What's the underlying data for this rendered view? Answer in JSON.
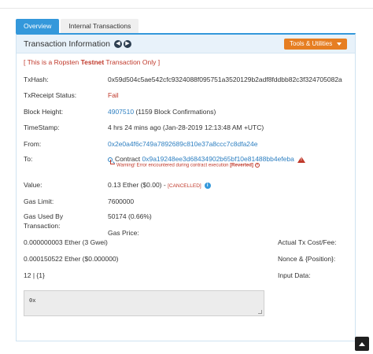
{
  "tabs": [
    {
      "label": "Overview",
      "active": true
    },
    {
      "label": "Internal Transactions",
      "active": false
    }
  ],
  "header": {
    "title": "Transaction Information",
    "tools_label": "Tools & Utilities"
  },
  "notice": {
    "prefix": "[ This is a Ropsten ",
    "bold": "Testnet",
    "suffix": " Transaction Only ]"
  },
  "fields": {
    "txhash_label": "TxHash:",
    "txhash_value": "0x59d504c5ae542cfc9324088f095751a3520129b2adf8fddbb82c3f324705082a",
    "receipt_label": "TxReceipt Status:",
    "receipt_value": "Fail",
    "block_label": "Block Height:",
    "block_value": "4907510",
    "block_confirm": " (1159 Block Confirmations)",
    "time_label": "TimeStamp:",
    "time_value": "4 hrs 24 mins ago (Jan-28-2019 12:13:48 AM +UTC)",
    "from_label": "From:",
    "from_value": "0x2e0a4f6c749a7892689c810e37a8ccc7c8dfa24e",
    "to_label": "To:",
    "to_prefix": "Contract ",
    "to_value": "0x9a19248ee3d68434902b65bf10e81488bb4efeba",
    "warning_prefix": "Warning! Error encountered during contract execution ",
    "warning_bold": "[Reverted]",
    "value_label": "Value:",
    "value_value": "0.13 Ether ($0.00) - ",
    "value_cancelled": "[CANCELLED]",
    "gaslimit_label": "Gas Limit:",
    "gaslimit_value": "7600000",
    "gasused_label_1": "Gas Used By",
    "gasused_label_2": "Transaction:",
    "gasused_value": "50174 (0.66%)",
    "gasprice_label": "Gas Price:",
    "gasprice_value": "0.000000003 Ether (3 Gwei)",
    "actualfee_label": "Actual Tx Cost/Fee:",
    "actualfee_value": "0.000150522 Ether ($0.000000)",
    "nonce_label": "Nonce & {Position}:",
    "nonce_value": "12 | {1}",
    "input_label": "Input Data:",
    "input_value": "0x"
  },
  "colors": {
    "accent": "#3498db",
    "tools": "#e67e22",
    "error": "#c0392b",
    "link": "#2d7fc1"
  }
}
